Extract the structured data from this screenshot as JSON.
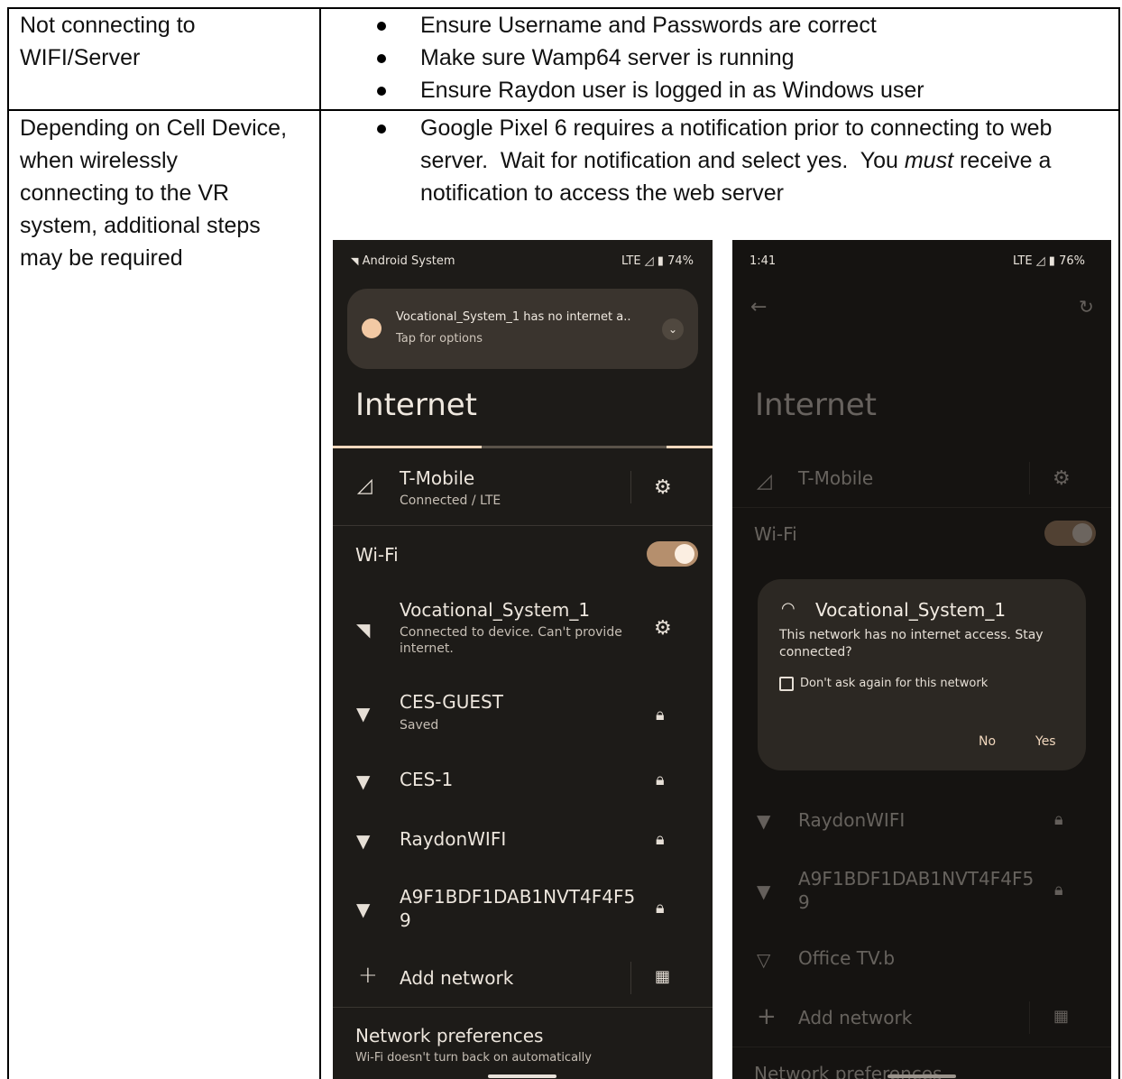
{
  "rows": [
    {
      "issue": [
        "Not connecting to",
        "WIFI/Server"
      ],
      "fixes": [
        "Ensure Username and Passwords are correct",
        "Make sure Wamp64 server is running",
        "Ensure Raydon user is logged in as Windows user"
      ]
    },
    {
      "issue": [
        "Depending on Cell Device,",
        "when wirelessly",
        "connecting to the VR",
        "system, additional steps",
        "may be required"
      ],
      "fix_lines": {
        "l1": "Google Pixel 6 requires a notification prior to connecting to web",
        "l2a": "server.  Wait for notification and select yes.  You ",
        "l2em": "must",
        "l2b": " receive a",
        "l3": "notification to access the web server"
      }
    }
  ],
  "phone1": {
    "status_left": "Android System",
    "status_right": "LTE ◿ ▮ 74%",
    "notif_title": "Vocational_System_1 has no internet a..",
    "notif_sub": "Tap for options",
    "title": "Internet",
    "carrier": "T-Mobile",
    "carrier_sub": "Connected / LTE",
    "wifi_label": "Wi-Fi",
    "networks": [
      {
        "name": "Vocational_System_1",
        "sub": "Connected to device. Can't provide",
        "sub2": "internet."
      },
      {
        "name": "CES-GUEST",
        "sub": "Saved"
      },
      {
        "name": "CES-1"
      },
      {
        "name": "RaydonWIFI"
      },
      {
        "name": "A9F1BDF1DAB1NVT4F4F5",
        "name2": "9"
      }
    ],
    "add_network": "Add network",
    "prefs_title": "Network preferences",
    "prefs_sub": "Wi-Fi doesn't turn back on automatically"
  },
  "phone2": {
    "status_left": "1:41",
    "status_right": "LTE ◿ ▮ 76%",
    "title": "Internet",
    "carrier": "T-Mobile",
    "wifi_label": "Wi-Fi",
    "dialog_title": "Vocational_System_1",
    "dialog_body_1": "This network has no internet access. Stay",
    "dialog_body_2": "connected?",
    "dialog_checkbox": "Don't ask again for this network",
    "dialog_no": "No",
    "dialog_yes": "Yes",
    "networks": [
      {
        "name": "RaydonWIFI"
      },
      {
        "name": "A9F1BDF1DAB1NVT4F4F5",
        "name2": "9"
      },
      {
        "name": "Office TV.b"
      }
    ],
    "add_network": "Add network",
    "prefs_title": "Network preferences"
  }
}
